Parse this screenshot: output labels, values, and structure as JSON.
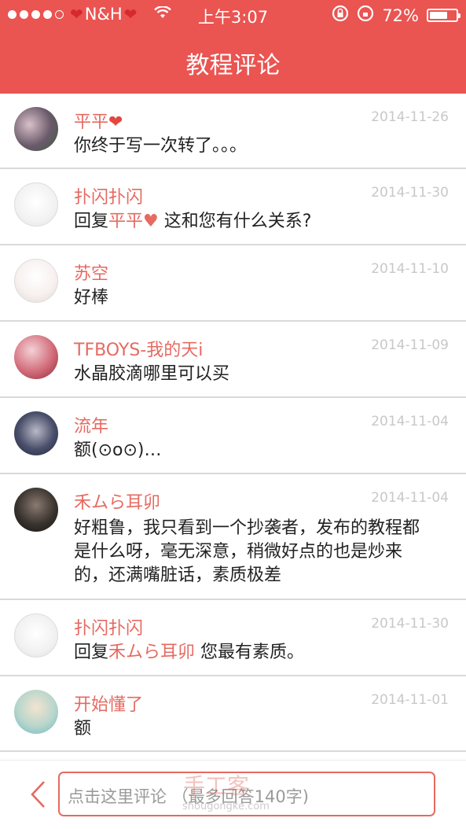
{
  "status_bar": {
    "carrier": "N&H",
    "time": "上午3:07",
    "battery": "72%",
    "battery_level": 0.72
  },
  "header": {
    "title": "教程评论"
  },
  "comments": [
    {
      "name": "平平",
      "name_suffix": "❤",
      "date": "2014-11-26",
      "text": "你终于写一次转了。。。"
    },
    {
      "name": "扑闪扑闪",
      "date": "2014-11-30",
      "reply_prefix": "回复",
      "reply_to": "平平♥",
      "text": " 这和您有什么关系?"
    },
    {
      "name": "苏空",
      "date": "2014-11-10",
      "text": "好棒"
    },
    {
      "name": "TFBOYS-我的天i",
      "date": "2014-11-09",
      "text": "水晶胶滴哪里可以买"
    },
    {
      "name": "流年",
      "date": "2014-11-04",
      "text": "额(⊙o⊙)…"
    },
    {
      "name": "禾ムら耳卯",
      "date": "2014-11-04",
      "text": "好粗鲁，我只看到一个抄袭者，发布的教程都是什么呀，毫无深意，稍微好点的也是炒来的，还满嘴脏话，素质极差"
    },
    {
      "name": "扑闪扑闪",
      "date": "2014-11-30",
      "reply_prefix": "回复",
      "reply_to": "禾ムら耳卯",
      "text": " 您最有素质。"
    },
    {
      "name": "开始懂了",
      "date": "2014-11-01",
      "text": "额"
    }
  ],
  "footer": {
    "placeholder": "点击这里评论 （最多回答140字)",
    "watermark": "手工客",
    "watermark_url": "shougongke.com"
  },
  "icons": {
    "wifi": "wifi-icon",
    "rotation_lock": "rotation-lock-icon",
    "lock": "lock-icon",
    "back": "chevron-left-icon"
  },
  "colors": {
    "brand": "#ea5451",
    "name": "#e66a61",
    "date": "#c8c8c8"
  }
}
